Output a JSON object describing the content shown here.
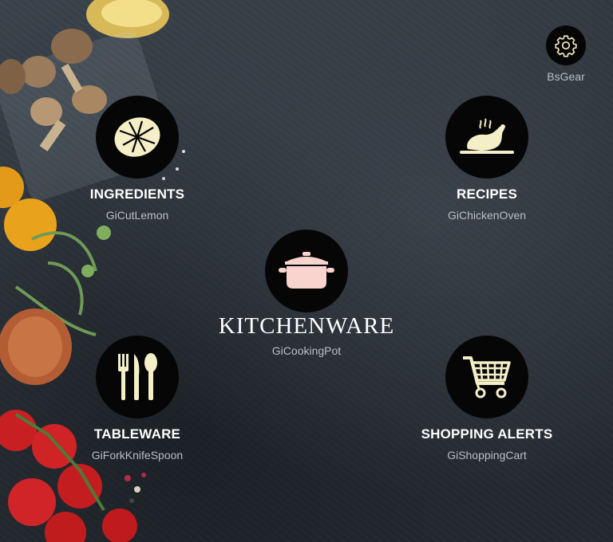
{
  "settings": {
    "icon": "gear-icon",
    "caption": "BsGear"
  },
  "center": {
    "label": "KITCHENWARE",
    "caption": "GiCookingPot",
    "icon": "cooking-pot-icon",
    "icon_color": "#f9d3cd"
  },
  "nodes": [
    {
      "key": "ingredients",
      "label": "INGREDIENTS",
      "caption": "GiCutLemon",
      "icon": "cut-lemon-icon"
    },
    {
      "key": "recipes",
      "label": "RECIPES",
      "caption": "GiChickenOven",
      "icon": "chicken-oven-icon"
    },
    {
      "key": "tableware",
      "label": "TABLEWARE",
      "caption": "GiForkKnifeSpoon",
      "icon": "fork-knife-spoon-icon"
    },
    {
      "key": "shopping",
      "label": "SHOPPING ALERTS",
      "caption": "GiShoppingCart",
      "icon": "shopping-cart-icon"
    }
  ],
  "colors": {
    "icon": "#f4efc6",
    "circle": "#060606",
    "background": "#2c333a",
    "caption": "#b9bec4"
  }
}
